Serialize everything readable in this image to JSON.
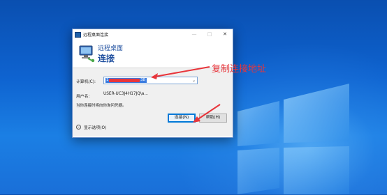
{
  "dialog": {
    "title": "远程桌面连接",
    "controls": {
      "minimize": "—",
      "maximize": "□",
      "close": "✕"
    },
    "banner_line1": "远程桌面",
    "banner_line2": "连接",
    "computer_label": "计算机(C):",
    "computer_value": "1",
    "computer_value_tail": "38",
    "username_label": "用户名:",
    "username_value": "USER-UC3J4H17JQ\\a...",
    "note": "当你连接时将向你询问凭据。",
    "show_options": "显示选项(O)",
    "connect_button": "连接(N)",
    "help_button": "帮助(H)"
  },
  "annotation": {
    "text": "复制连接地址",
    "color": "#e8353b"
  },
  "icons": {
    "app": "remote-desktop-icon",
    "banner": "monitor-network-icon",
    "options": "chevron-down-circle-icon",
    "dropdown": "chevron-down-icon"
  },
  "colors": {
    "accent": "#0078d7",
    "banner_text": "#1f4f9f",
    "desktop": "#0e63d0"
  }
}
